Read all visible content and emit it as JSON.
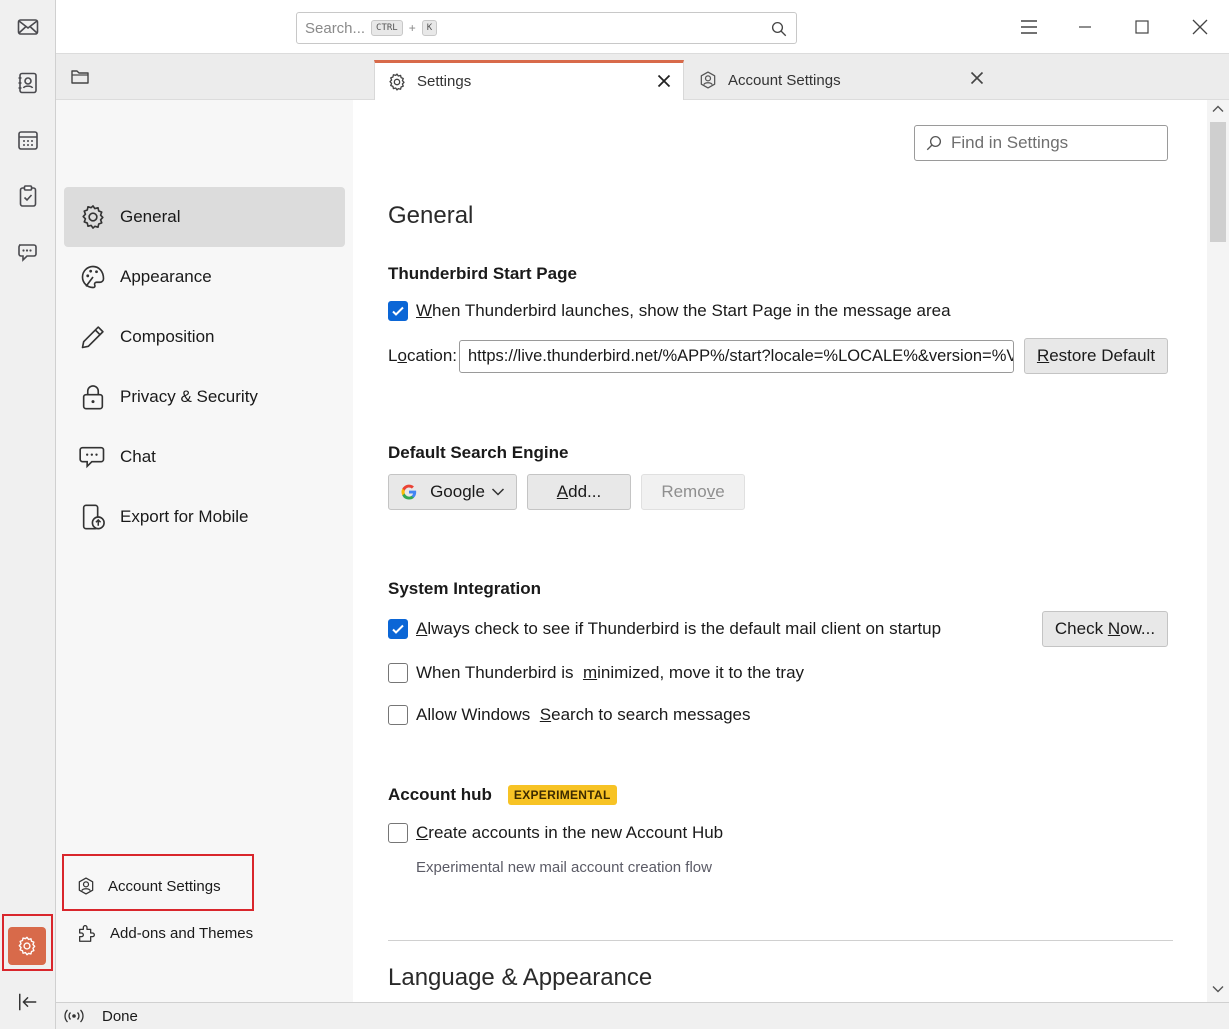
{
  "titlebar": {
    "search_placeholder": "Search...",
    "shortcut_key1": "CTRL",
    "shortcut_plus": "+",
    "shortcut_key2": "K"
  },
  "spaces": {
    "items": [
      "mail-icon",
      "address-book-icon",
      "calendar-icon",
      "tasks-icon",
      "chat-icon"
    ],
    "settings_icon": "gear-icon",
    "collapse_icon": "collapse-left-icon"
  },
  "tabs": [
    {
      "label": "Settings",
      "icon": "gear-icon",
      "active": true
    },
    {
      "label": "Account Settings",
      "icon": "account-icon",
      "active": false
    }
  ],
  "sidebar": {
    "categories": [
      {
        "label": "General",
        "icon": "gear-icon",
        "selected": true
      },
      {
        "label": "Appearance",
        "icon": "palette-icon"
      },
      {
        "label": "Composition",
        "icon": "pencil-icon"
      },
      {
        "label": "Privacy & Security",
        "icon": "lock-icon"
      },
      {
        "label": "Chat",
        "icon": "chat-icon"
      },
      {
        "label": "Export for Mobile",
        "icon": "phone-icon"
      }
    ],
    "footer": {
      "account_settings": "Account Settings",
      "addons": "Add-ons and Themes"
    }
  },
  "content": {
    "find_placeholder": "Find in Settings",
    "page_title": "General",
    "start_page": {
      "heading": "Thunderbird Start Page",
      "checkbox_pre": "",
      "checkbox_accel": "W",
      "checkbox_post": "hen Thunderbird launches, show the Start Page in the message area",
      "checked": true,
      "location_pre": "L",
      "location_accel": "o",
      "location_post": "cation:",
      "location_value": "https://live.thunderbird.net/%APP%/start?locale=%LOCALE%&version=%VERSION%",
      "restore_accel": "R",
      "restore_post": "estore Default"
    },
    "search_engine": {
      "heading": "Default Search Engine",
      "selected": "Google",
      "add_accel": "A",
      "add_post": "dd...",
      "remove_pre": "Remo",
      "remove_accel": "v",
      "remove_post": "e"
    },
    "system": {
      "heading": "System Integration",
      "opt1_accel": "A",
      "opt1_post": "lways check to see if Thunderbird is the default mail client on startup",
      "opt1_checked": true,
      "check_now_pre": "Check ",
      "check_now_accel": "N",
      "check_now_post": "ow...",
      "opt2_pre": "When Thunderbird is ",
      "opt2_accel": "m",
      "opt2_post": "inimized, move it to the tray",
      "opt2_checked": false,
      "opt3_pre": "Allow Windows ",
      "opt3_accel": "S",
      "opt3_post": "earch to search messages",
      "opt3_checked": false
    },
    "account_hub": {
      "heading": "Account hub",
      "badge": "EXPERIMENTAL",
      "opt_accel": "C",
      "opt_post": "reate accounts in the new Account Hub",
      "opt_checked": false,
      "description": "Experimental new mail account creation flow"
    },
    "next_section": "Language & Appearance"
  },
  "statusbar": {
    "text": "Done"
  },
  "colors": {
    "accent": "#d86a4a",
    "checkbox": "#0b66d6",
    "highlight_box": "#d9262c",
    "badge": "#f7c325"
  }
}
